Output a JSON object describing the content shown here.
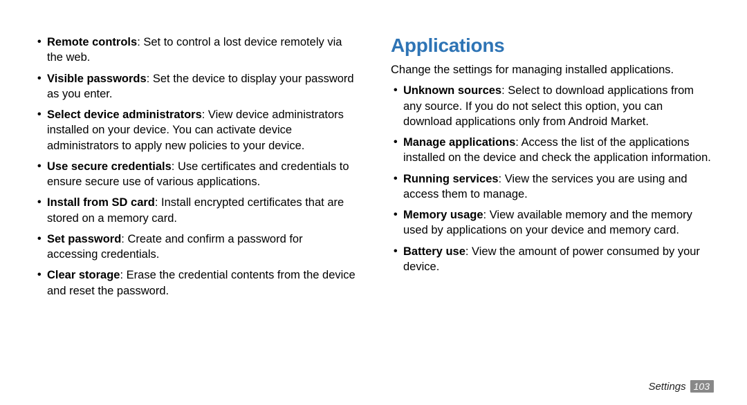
{
  "left_column": {
    "items": [
      {
        "term": "Remote controls",
        "desc": ": Set to control a lost device remotely via the web."
      },
      {
        "term": "Visible passwords",
        "desc": ": Set the device to display your password as you enter."
      },
      {
        "term": "Select device administrators",
        "desc": ": View device administrators installed on your device. You can activate device administrators to apply new policies to your device."
      },
      {
        "term": "Use secure credentials",
        "desc": ": Use certificates and credentials to ensure secure use of various applications."
      },
      {
        "term": "Install from SD card",
        "desc": ": Install encrypted certificates that are stored on a memory card."
      },
      {
        "term": "Set password",
        "desc": ": Create and confirm a password for accessing credentials."
      },
      {
        "term": "Clear storage",
        "desc": ": Erase the credential contents from the device and reset the password."
      }
    ]
  },
  "right_column": {
    "heading": "Applications",
    "intro": "Change the settings for managing installed applications.",
    "items": [
      {
        "term": "Unknown sources",
        "desc": ": Select to download applications from any source. If you do not select this option, you can download applications only from Android Market."
      },
      {
        "term": "Manage applications",
        "desc": ": Access the list of the applications installed on the device and check the application information."
      },
      {
        "term": "Running services",
        "desc": ": View the services you are using and access them to manage."
      },
      {
        "term": "Memory usage",
        "desc": ": View available memory and the memory used by applications on your device and memory card."
      },
      {
        "term": "Battery use",
        "desc": ": View the amount of power consumed by your device."
      }
    ]
  },
  "footer": {
    "section": "Settings",
    "page_number": "103"
  }
}
